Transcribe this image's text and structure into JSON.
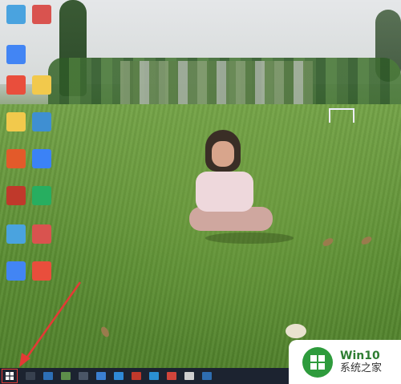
{
  "desktop": {
    "icons": [
      {
        "name": "desktop-icon-1",
        "color": "#4aa3df"
      },
      {
        "name": "desktop-icon-2",
        "color": "#d9534f"
      },
      {
        "name": "desktop-icon-3",
        "color": "#4285f4"
      },
      {
        "name": "desktop-icon-4",
        "color": "#e94e3c"
      },
      {
        "name": "desktop-icon-5",
        "color": "#f2c94c"
      },
      {
        "name": "desktop-icon-6",
        "color": "#f2c94c"
      },
      {
        "name": "desktop-icon-7",
        "color": "#3f8fd2"
      },
      {
        "name": "desktop-icon-8",
        "color": "#e35a2a"
      },
      {
        "name": "desktop-icon-9",
        "color": "#3b82f6"
      },
      {
        "name": "desktop-icon-10",
        "color": "#c0392b"
      },
      {
        "name": "desktop-icon-11",
        "color": "#27ae60"
      }
    ]
  },
  "taskbar": {
    "start_icon": "windows-logo-icon",
    "highlight_color": "#e53935"
  },
  "watermark": {
    "title": "Win10",
    "subtitle": "系统之家",
    "accent": "#2e9b3c"
  }
}
